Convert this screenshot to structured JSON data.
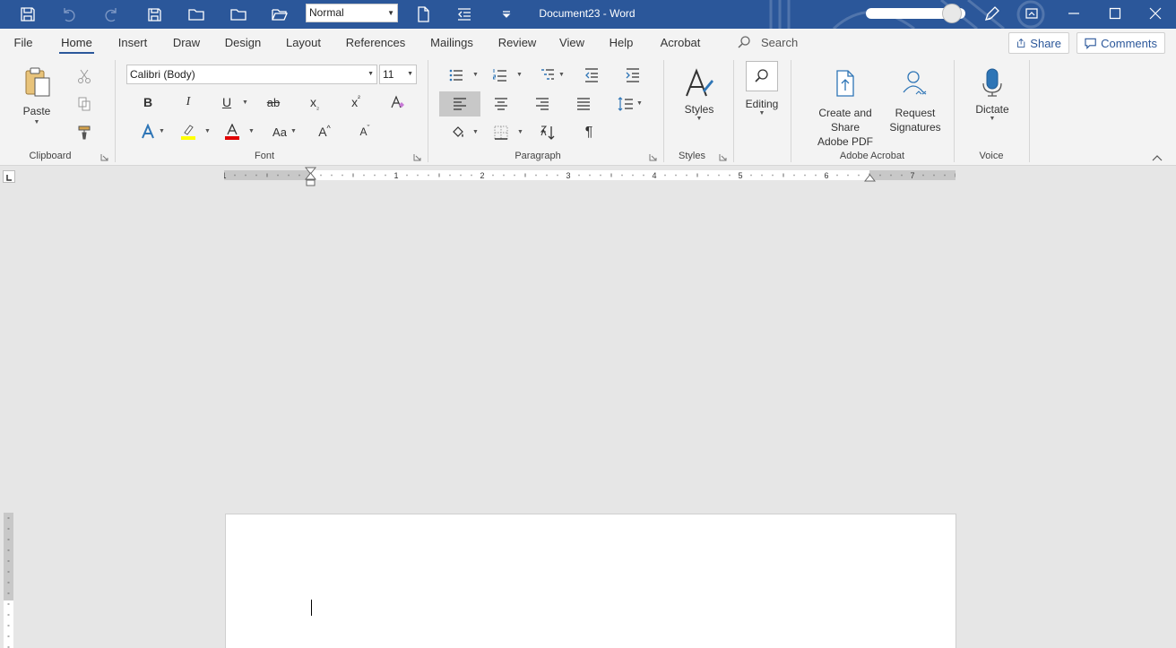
{
  "app": {
    "doc_title": "Document23  -  Word"
  },
  "quick_access": {
    "style_value": "Normal"
  },
  "tabs": [
    "File",
    "Home",
    "Insert",
    "Draw",
    "Design",
    "Layout",
    "References",
    "Mailings",
    "Review",
    "View",
    "Help",
    "Acrobat"
  ],
  "active_tab": "Home",
  "search": {
    "label": "Search"
  },
  "share": {
    "label": "Share"
  },
  "comments": {
    "label": "Comments"
  },
  "ribbon": {
    "clipboard": {
      "group": "Clipboard",
      "paste": "Paste"
    },
    "font": {
      "group": "Font",
      "font_name": "Calibri (Body)",
      "font_size": "11",
      "bold": "B",
      "italic": "I",
      "underline": "U",
      "strike": "ab",
      "subscript": "x",
      "superscript": "x",
      "case": "Aa",
      "grow": "A",
      "shrink": "A",
      "color_a": "A"
    },
    "paragraph": {
      "group": "Paragraph",
      "pilcrow": "¶"
    },
    "styles": {
      "group": "Styles",
      "label": "Styles"
    },
    "editing": {
      "label": "Editing"
    },
    "acrobat": {
      "group": "Adobe Acrobat",
      "create_share_l1": "Create and Share",
      "create_share_l2": "Adobe PDF",
      "request_l1": "Request",
      "request_l2": "Signatures"
    },
    "voice": {
      "group": "Voice",
      "dictate": "Dictate"
    }
  },
  "ruler": {
    "labels": [
      "1",
      "1",
      "2",
      "3",
      "4",
      "5",
      "6",
      "7"
    ]
  },
  "colors": {
    "title_bar": "#2b579a",
    "ribbon": "#f3f3f3",
    "canvas": "#e6e6e6",
    "highlight": "#ffff00",
    "font_color": "#e00000"
  }
}
